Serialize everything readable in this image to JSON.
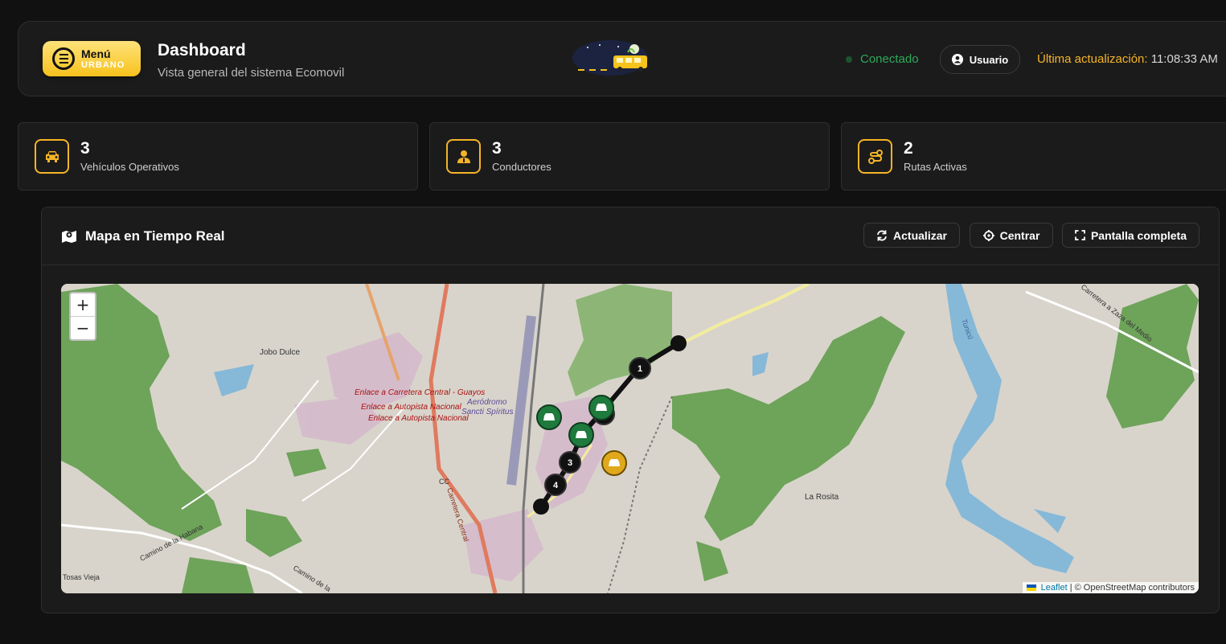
{
  "header": {
    "menu_label": "Menú",
    "menu_sublabel": "URBANO",
    "title": "Dashboard",
    "subtitle": "Vista general del sistema Ecomovil",
    "status": "Conectado",
    "user_label": "Usuario",
    "last_update_label": "Última actualización:",
    "last_update_time": "11:08:33 AM",
    "colors": {
      "accent": "#f5b428",
      "status": "#2ea85a"
    }
  },
  "stats": [
    {
      "value": "3",
      "label": "Vehículos Operativos",
      "icon": "car-icon"
    },
    {
      "value": "3",
      "label": "Conductores",
      "icon": "driver-icon"
    },
    {
      "value": "2",
      "label": "Rutas Activas",
      "icon": "route-icon"
    }
  ],
  "map_panel": {
    "title": "Mapa en Tiempo Real",
    "buttons": {
      "refresh": "Actualizar",
      "center": "Centrar",
      "fullscreen": "Pantalla completa"
    },
    "zoom_in": "+",
    "zoom_out": "−",
    "attribution_link": "Leaflet",
    "attribution_text": "| © OpenStreetMap contributors",
    "place_labels": {
      "jobo_dulce": "Jobo Dulce",
      "enlace_central": "Enlace a Carretera Central - Guayos",
      "enlace_autopista_1": "Enlace a Autopista Nacional",
      "enlace_autopista_2": "Enlace a Autopista Nacional",
      "aerodromo_1": "Aeródromo",
      "aerodromo_2": "Sancti Spíritus",
      "la_rosita": "La Rosita",
      "cc": "CC",
      "carretera_central": "Carretera Central",
      "camino_habana": "Camino de la Habana",
      "tosas_vieja": "Tosas Vieja",
      "camino_de_la": "Camino de la",
      "carretera_zaza": "Carretera a Zaza del Medio",
      "tunicu": "Tunicú"
    },
    "route_stops": [
      "1",
      "2",
      "3",
      "4"
    ]
  }
}
